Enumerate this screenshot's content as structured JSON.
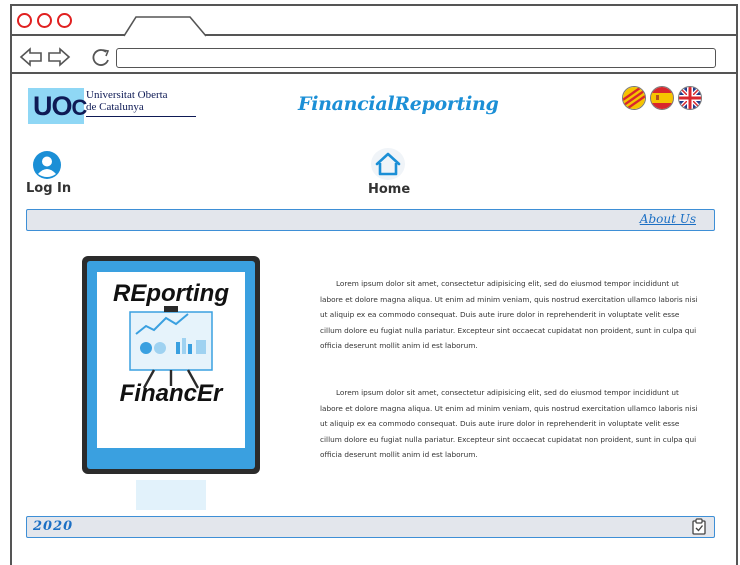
{
  "browser": {
    "address_value": ""
  },
  "header": {
    "logo_mark": "UOC",
    "logo_line1": "Universitat Oberta",
    "logo_line2": "de Catalunya",
    "app_title": "FinancialReporting",
    "languages": [
      {
        "name": "catalan-flag-icon",
        "colors": [
          "#f5c400",
          "#d8262c"
        ]
      },
      {
        "name": "spanish-flag-icon",
        "colors": [
          "#d8262c",
          "#f5c400"
        ]
      },
      {
        "name": "english-flag-icon",
        "colors": [
          "#1f3a8a",
          "#ffffff",
          "#d8262c"
        ]
      }
    ]
  },
  "nav": {
    "login_label": "Log In",
    "home_label": "Home"
  },
  "top_bar": {
    "about_label": "About Us"
  },
  "illustration": {
    "word1": "REporting",
    "word2": "FinancEr"
  },
  "content": {
    "paragraphs": [
      "Lorem ipsum dolor sit amet, consectetur adipisicing elit, sed do eiusmod tempor incididunt ut labore et dolore magna aliqua. Ut enim ad minim veniam, quis nostrud exercitation ullamco laboris nisi ut aliquip ex ea commodo consequat. Duis aute irure dolor in reprehenderit in voluptate velit esse cillum dolore eu fugiat nulla pariatur. Excepteur sint occaecat cupidatat non proident, sunt in culpa qui officia deserunt mollit anim id est laborum.",
      "Lorem ipsum dolor sit amet, consectetur adipisicing elit, sed do eiusmod tempor incididunt ut labore et dolore magna aliqua. Ut enim ad minim veniam, quis nostrud exercitation ullamco laboris nisi ut aliquip ex ea commodo consequat. Duis aute irure dolor in reprehenderit in voluptate velit esse cillum dolore eu fugiat nulla pariatur. Excepteur sint occaecat cupidatat non proident, sunt in culpa qui officia deserunt mollit anim id est laborum."
    ]
  },
  "footer": {
    "year": "2020"
  },
  "colors": {
    "accent": "#1b8fd6",
    "bar_background": "#e3e6ec",
    "bar_border": "#3e8fd6"
  }
}
